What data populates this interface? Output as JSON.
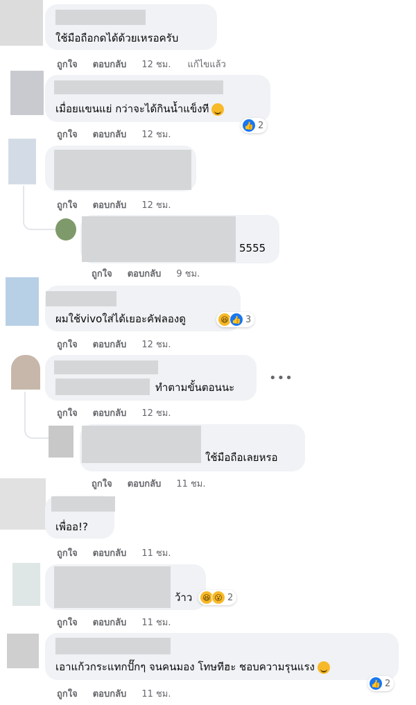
{
  "actions": {
    "like": "ถูกใจ",
    "reply": "ตอบกลับ",
    "edited": "แก้ไขแล้ว"
  },
  "comments": [
    {
      "text": "ใช้มือถือกดได้ด้วยเหรอครับ",
      "time": "12 ชม."
    },
    {
      "text": "เมื่อยแขนแย่ กว่าจะได้กินน้ำแข็งที",
      "time": "12 ชม.",
      "reaction_count": "2"
    },
    {
      "text": "",
      "time": "12 ชม."
    },
    {
      "text": "5555",
      "time": "9 ชม."
    },
    {
      "text": "ผมใช้vivoใส่ได้เยอะคัฟลองดู",
      "time": "12 ชม.",
      "reaction_count": "3"
    },
    {
      "text": "ทำตามขั้นตอนนะ",
      "time": "12 ชม."
    },
    {
      "text": "ใช้มือถือเลยหรอ",
      "time": "11 ชม."
    },
    {
      "text": "เพื่ออ!?",
      "time": "11 ชม."
    },
    {
      "text": "ว้าว",
      "time": "11 ชม.",
      "reaction_count": "2"
    },
    {
      "text": "เอาแก้วกระแทกปั๊กๆ จนคนมอง โทษทีฮะ ชอบความรุนแรง",
      "time": "11 ชม.",
      "reaction_count": "2"
    }
  ],
  "more_label": "•••"
}
